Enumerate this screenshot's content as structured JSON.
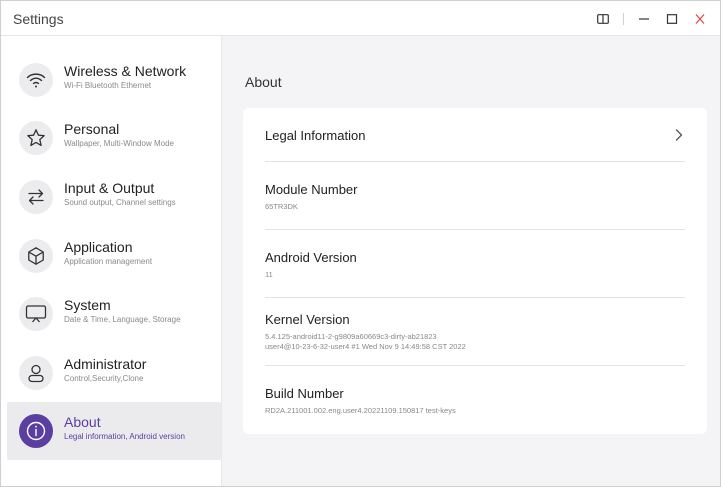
{
  "window": {
    "title": "Settings"
  },
  "colors": {
    "accent": "#5a3fa0",
    "close": "#e04b4b"
  },
  "sidebar": {
    "items": [
      {
        "label": "Wireless & Network",
        "sub": "Wi-Fi Bluetooth Ethernet",
        "icon": "wifi-icon"
      },
      {
        "label": "Personal",
        "sub": "Wallpaper, Multi-Window Mode",
        "icon": "star-icon"
      },
      {
        "label": "Input & Output",
        "sub": "Sound output, Channel settings",
        "icon": "arrows-icon"
      },
      {
        "label": "Application",
        "sub": "Application management",
        "icon": "cube-icon"
      },
      {
        "label": "System",
        "sub": "Date & Time, Language, Storage",
        "icon": "monitor-icon"
      },
      {
        "label": "Administrator",
        "sub": "Control,Security,Clone",
        "icon": "user-icon"
      },
      {
        "label": "About",
        "sub": "Legal information, Android version",
        "icon": "info-icon"
      }
    ]
  },
  "main": {
    "title": "About",
    "rows": [
      {
        "label": "Legal Information"
      },
      {
        "label": "Module Number",
        "value": "65TR3DK"
      },
      {
        "label": "Android Version",
        "value": "11"
      },
      {
        "label": "Kernel Version",
        "value": "5.4.125-android11-2-g9809a60669c3-dirty-ab21823",
        "value2": "user4@10-23-6-32-user4 #1 Wed Nov 9 14:49:58 CST 2022"
      },
      {
        "label": "Build Number",
        "value": "RD2A.211001.002.eng.user4.20221109.150817 test-keys"
      }
    ]
  }
}
